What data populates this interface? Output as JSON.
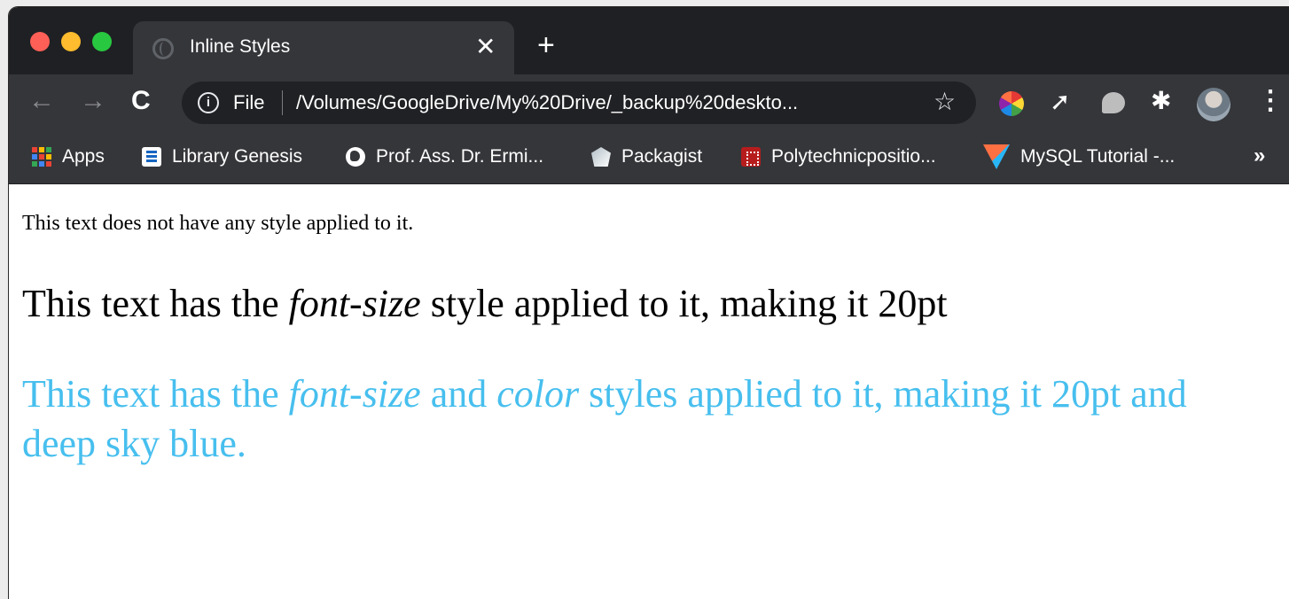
{
  "window": {
    "traffic_lights": {
      "close": "#fe5f57",
      "minimize": "#febc2e",
      "zoom": "#28c840"
    }
  },
  "tab": {
    "title": "Inline Styles",
    "favicon": "globe-icon",
    "close_label": "✕",
    "new_tab_label": "+"
  },
  "toolbar": {
    "back_label": "←",
    "forward_label": "→",
    "reload_label": "C",
    "omnibox": {
      "info_label": "i",
      "scheme_label": "File",
      "url": "/Volumes/GoogleDrive/My%20Drive/_backup%20deskto...",
      "bookmark_star": "☆"
    },
    "extensions": [
      "color-wheel-icon",
      "cursor-icon",
      "bubble-icon",
      "puzzle-icon"
    ],
    "cursor_label": "➚",
    "puzzle_label": "✱",
    "menu_label": "⋮"
  },
  "bookmarks": {
    "items": [
      {
        "label": "Apps",
        "icon": "apps-grid-icon"
      },
      {
        "label": "Library Genesis",
        "icon": "library-icon"
      },
      {
        "label": "Prof. Ass. Dr. Ermi...",
        "icon": "globe-icon"
      },
      {
        "label": "Packagist",
        "icon": "packagist-icon"
      },
      {
        "label": "Polytechnicpositio...",
        "icon": "polytechnic-icon"
      },
      {
        "label": "MySQL Tutorial -...",
        "icon": "mysql-icon"
      }
    ],
    "more_label": "»"
  },
  "page": {
    "plain": "This text does not have any style applied to it.",
    "sized": {
      "before": "This text has the ",
      "em": "font-size",
      "after": " style applied to it, making it 20pt"
    },
    "colored": {
      "before": "This text has the ",
      "em1": "font-size",
      "mid": " and ",
      "em2": "color",
      "after": " styles applied to it, making it 20pt and",
      "line2": "deep sky blue."
    },
    "colored_text_color": "#47bfee"
  }
}
